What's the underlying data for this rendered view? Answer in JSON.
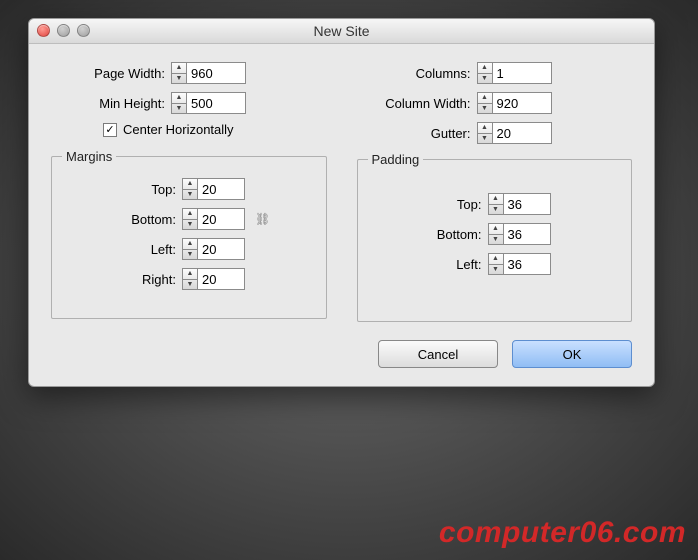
{
  "window": {
    "title": "New Site"
  },
  "page": {
    "width_label": "Page Width:",
    "width_value": "960",
    "min_height_label": "Min Height:",
    "min_height_value": "500",
    "center_label": "Center Horizontally",
    "center_checked": "✓"
  },
  "columns": {
    "columns_label": "Columns:",
    "columns_value": "1",
    "column_width_label": "Column Width:",
    "column_width_value": "920",
    "gutter_label": "Gutter:",
    "gutter_value": "20"
  },
  "margins": {
    "legend": "Margins",
    "top_label": "Top:",
    "top_value": "20",
    "bottom_label": "Bottom:",
    "bottom_value": "20",
    "left_label": "Left:",
    "left_value": "20",
    "right_label": "Right:",
    "right_value": "20"
  },
  "padding": {
    "legend": "Padding",
    "top_label": "Top:",
    "top_value": "36",
    "bottom_label": "Bottom:",
    "bottom_value": "36",
    "left_label": "Left:",
    "left_value": "36"
  },
  "buttons": {
    "cancel": "Cancel",
    "ok": "OK"
  },
  "watermark": "computer06.com"
}
